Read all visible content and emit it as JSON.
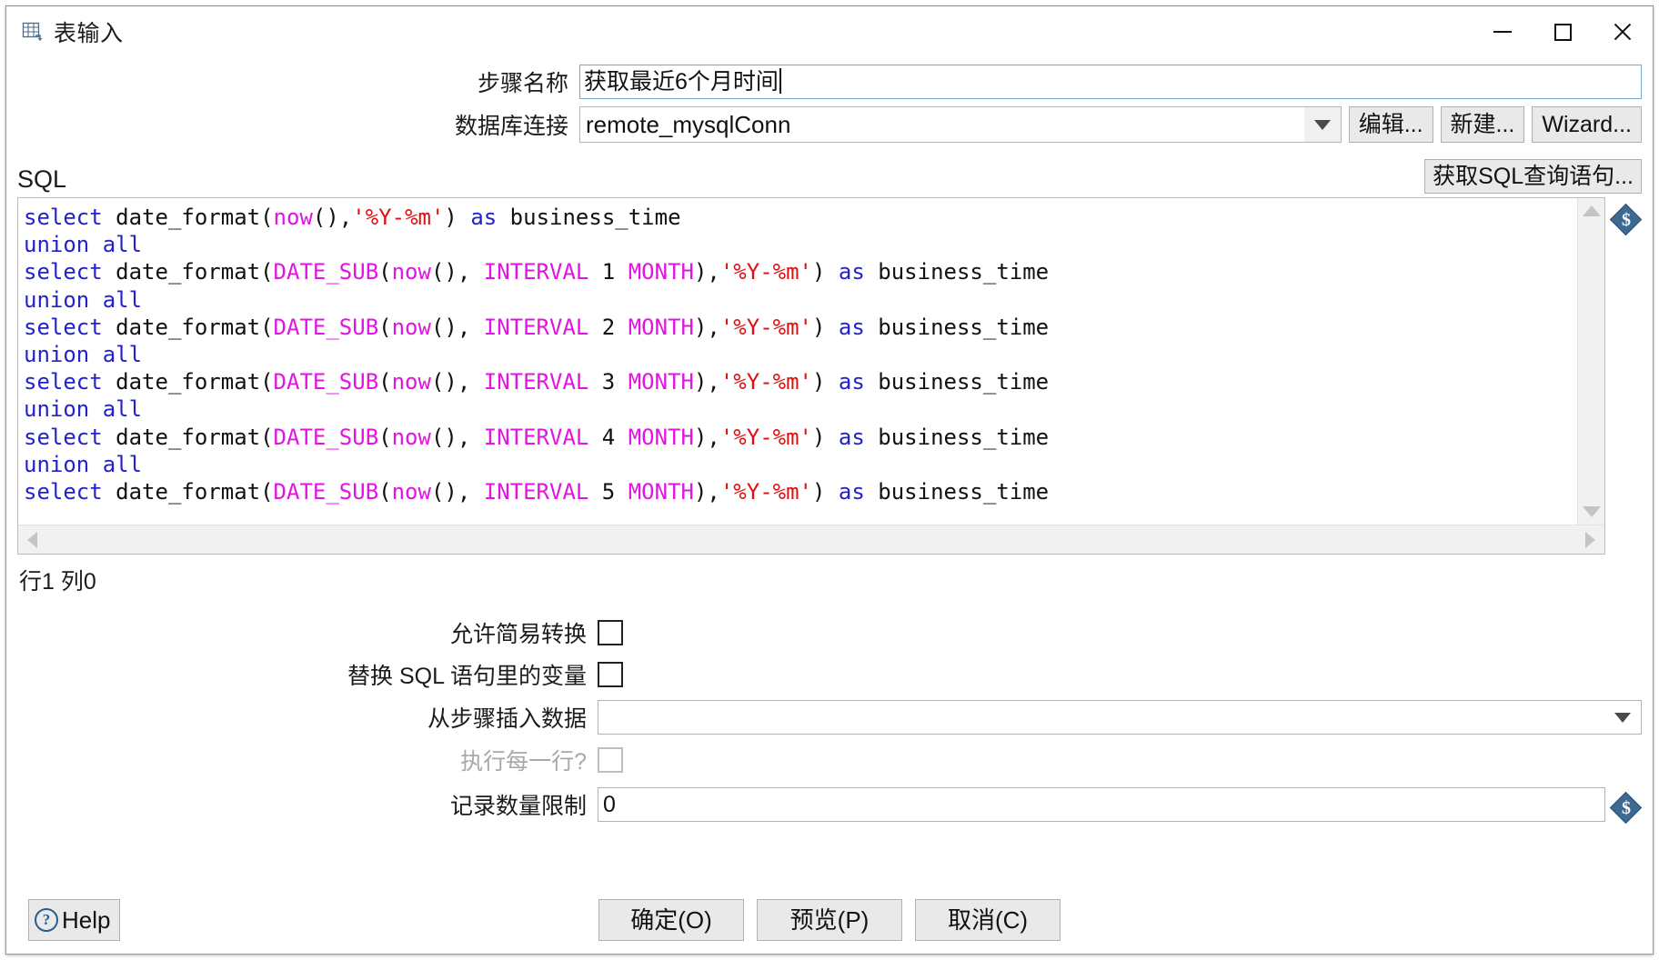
{
  "window": {
    "title": "表输入",
    "icon": "table-input-icon",
    "minimize_label": "minimize",
    "maximize_label": "maximize",
    "close_label": "close"
  },
  "form": {
    "step_name_label": "步骤名称",
    "step_name_value": "获取最近6个月时间",
    "connection_label": "数据库连接",
    "connection_value": "remote_mysqlConn",
    "edit_button": "编辑...",
    "new_button": "新建...",
    "wizard_button": "Wizard..."
  },
  "sql": {
    "section_label": "SQL",
    "get_sql_button": "获取SQL查询语句...",
    "status": "行1 列0",
    "variable_icon": "$",
    "lines": [
      [
        {
          "t": "select",
          "c": "k"
        },
        {
          "t": " date_format(",
          "c": "pl"
        },
        {
          "t": "now",
          "c": "fn"
        },
        {
          "t": "(),",
          "c": "pl"
        },
        {
          "t": "'%Y-%m'",
          "c": "str"
        },
        {
          "t": ") ",
          "c": "pl"
        },
        {
          "t": "as",
          "c": "k"
        },
        {
          "t": " business_time",
          "c": "pl"
        }
      ],
      [
        {
          "t": "union all",
          "c": "k"
        }
      ],
      [
        {
          "t": "select",
          "c": "k"
        },
        {
          "t": " date_format(",
          "c": "pl"
        },
        {
          "t": "DATE_SUB",
          "c": "fn"
        },
        {
          "t": "(",
          "c": "pl"
        },
        {
          "t": "now",
          "c": "fn"
        },
        {
          "t": "(), ",
          "c": "pl"
        },
        {
          "t": "INTERVAL",
          "c": "fn"
        },
        {
          "t": " 1 ",
          "c": "pl"
        },
        {
          "t": "MONTH",
          "c": "fn"
        },
        {
          "t": "),",
          "c": "pl"
        },
        {
          "t": "'%Y-%m'",
          "c": "str"
        },
        {
          "t": ") ",
          "c": "pl"
        },
        {
          "t": "as",
          "c": "k"
        },
        {
          "t": " business_time",
          "c": "pl"
        }
      ],
      [
        {
          "t": "union all",
          "c": "k"
        }
      ],
      [
        {
          "t": "select",
          "c": "k"
        },
        {
          "t": " date_format(",
          "c": "pl"
        },
        {
          "t": "DATE_SUB",
          "c": "fn"
        },
        {
          "t": "(",
          "c": "pl"
        },
        {
          "t": "now",
          "c": "fn"
        },
        {
          "t": "(), ",
          "c": "pl"
        },
        {
          "t": "INTERVAL",
          "c": "fn"
        },
        {
          "t": " 2 ",
          "c": "pl"
        },
        {
          "t": "MONTH",
          "c": "fn"
        },
        {
          "t": "),",
          "c": "pl"
        },
        {
          "t": "'%Y-%m'",
          "c": "str"
        },
        {
          "t": ") ",
          "c": "pl"
        },
        {
          "t": "as",
          "c": "k"
        },
        {
          "t": " business_time",
          "c": "pl"
        }
      ],
      [
        {
          "t": "union all",
          "c": "k"
        }
      ],
      [
        {
          "t": "select",
          "c": "k"
        },
        {
          "t": " date_format(",
          "c": "pl"
        },
        {
          "t": "DATE_SUB",
          "c": "fn"
        },
        {
          "t": "(",
          "c": "pl"
        },
        {
          "t": "now",
          "c": "fn"
        },
        {
          "t": "(), ",
          "c": "pl"
        },
        {
          "t": "INTERVAL",
          "c": "fn"
        },
        {
          "t": " 3 ",
          "c": "pl"
        },
        {
          "t": "MONTH",
          "c": "fn"
        },
        {
          "t": "),",
          "c": "pl"
        },
        {
          "t": "'%Y-%m'",
          "c": "str"
        },
        {
          "t": ") ",
          "c": "pl"
        },
        {
          "t": "as",
          "c": "k"
        },
        {
          "t": " business_time",
          "c": "pl"
        }
      ],
      [
        {
          "t": "union all",
          "c": "k"
        }
      ],
      [
        {
          "t": "select",
          "c": "k"
        },
        {
          "t": " date_format(",
          "c": "pl"
        },
        {
          "t": "DATE_SUB",
          "c": "fn"
        },
        {
          "t": "(",
          "c": "pl"
        },
        {
          "t": "now",
          "c": "fn"
        },
        {
          "t": "(), ",
          "c": "pl"
        },
        {
          "t": "INTERVAL",
          "c": "fn"
        },
        {
          "t": " 4 ",
          "c": "pl"
        },
        {
          "t": "MONTH",
          "c": "fn"
        },
        {
          "t": "),",
          "c": "pl"
        },
        {
          "t": "'%Y-%m'",
          "c": "str"
        },
        {
          "t": ") ",
          "c": "pl"
        },
        {
          "t": "as",
          "c": "k"
        },
        {
          "t": " business_time",
          "c": "pl"
        }
      ],
      [
        {
          "t": "union all",
          "c": "k"
        }
      ],
      [
        {
          "t": "select",
          "c": "k"
        },
        {
          "t": " date_format(",
          "c": "pl"
        },
        {
          "t": "DATE_SUB",
          "c": "fn"
        },
        {
          "t": "(",
          "c": "pl"
        },
        {
          "t": "now",
          "c": "fn"
        },
        {
          "t": "(), ",
          "c": "pl"
        },
        {
          "t": "INTERVAL",
          "c": "fn"
        },
        {
          "t": " 5 ",
          "c": "pl"
        },
        {
          "t": "MONTH",
          "c": "fn"
        },
        {
          "t": "),",
          "c": "pl"
        },
        {
          "t": "'%Y-%m'",
          "c": "str"
        },
        {
          "t": ") ",
          "c": "pl"
        },
        {
          "t": "as",
          "c": "k"
        },
        {
          "t": " business_time",
          "c": "pl"
        }
      ]
    ]
  },
  "options": {
    "lazy_conversion_label": "允许简易转换",
    "lazy_conversion_checked": false,
    "replace_variables_label": "替换 SQL 语句里的变量",
    "replace_variables_checked": false,
    "insert_data_from_step_label": "从步骤插入数据",
    "insert_data_from_step_value": "",
    "execute_each_row_label": "执行每一行?",
    "execute_each_row_checked": false,
    "execute_each_row_disabled": true,
    "row_limit_label": "记录数量限制",
    "row_limit_value": "0"
  },
  "footer": {
    "help_label": "Help",
    "ok_label": "确定(O)",
    "preview_label": "预览(P)",
    "cancel_label": "取消(C)"
  },
  "colors": {
    "keyword": "#2222cc",
    "function": "#e313e3",
    "string": "#e01010",
    "plain": "#111111",
    "variable_badge": "#3d6a93"
  }
}
